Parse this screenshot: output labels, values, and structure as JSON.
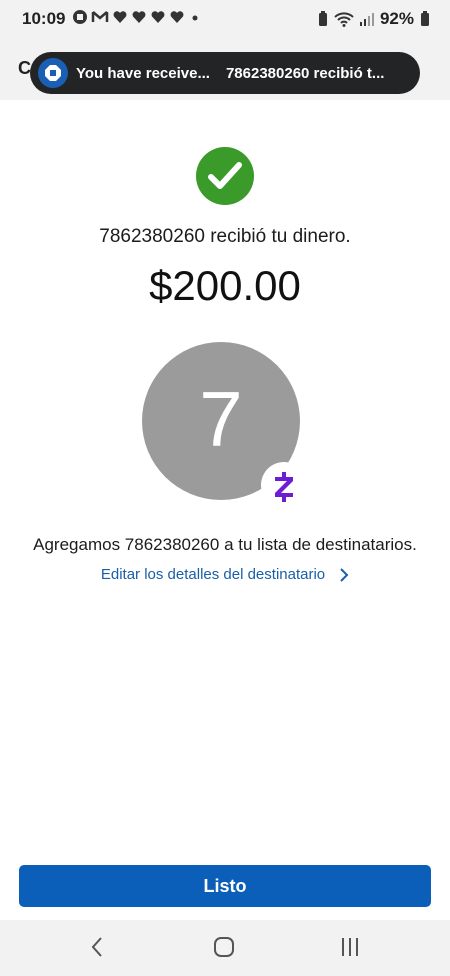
{
  "status_bar": {
    "time": "10:09",
    "battery": "92%",
    "icons": [
      "chase-icon",
      "gmail-icon",
      "heart-icon",
      "heart-icon",
      "heart-icon",
      "heart-icon",
      "dot-icon",
      "battery-saver-icon",
      "wifi-icon",
      "signal-icon",
      "battery-icon"
    ]
  },
  "header": {
    "letter": "C"
  },
  "notification": {
    "title": "You have receive...",
    "text": "7862380260 recibió t..."
  },
  "confirmation": {
    "message": "7862380260 recibió tu dinero.",
    "amount": "$200.00"
  },
  "recipient": {
    "initial": "7",
    "added_message": "Agregamos 7862380260 a tu lista de destinatarios.",
    "edit_link": "Editar los detalles del destinatario"
  },
  "done_button": {
    "label": "Listo"
  },
  "nav": {
    "items": [
      "back-icon",
      "home-icon",
      "recents-icon"
    ]
  },
  "colors": {
    "accent": "#0c5fb8",
    "success": "#3a9a2a",
    "zelle": "#6d1ed4",
    "avatar": "#9b9b9b",
    "link": "#1a5fa8"
  }
}
